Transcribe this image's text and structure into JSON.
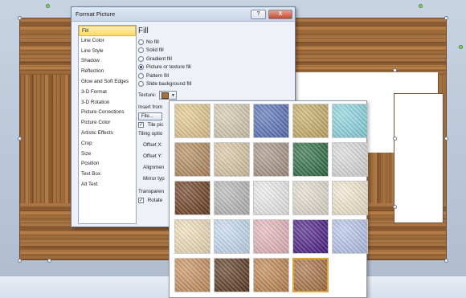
{
  "dialog": {
    "title": "Format Picture",
    "help_label": "?",
    "close_label": "X",
    "categories": [
      {
        "label": "Fill"
      },
      {
        "label": "Line Color"
      },
      {
        "label": "Line Style"
      },
      {
        "label": "Shadow"
      },
      {
        "label": "Reflection"
      },
      {
        "label": "Glow and Soft Edges"
      },
      {
        "label": "3-D Format"
      },
      {
        "label": "3-D Rotation"
      },
      {
        "label": "Picture Corrections"
      },
      {
        "label": "Picture Color"
      },
      {
        "label": "Artistic Effects"
      },
      {
        "label": "Crop"
      },
      {
        "label": "Size"
      },
      {
        "label": "Position"
      },
      {
        "label": "Text Box"
      },
      {
        "label": "Alt Text"
      }
    ],
    "fill": {
      "heading": "Fill",
      "options": [
        {
          "label": "No fill",
          "selected": false
        },
        {
          "label": "Solid fill",
          "selected": false
        },
        {
          "label": "Gradient fill",
          "selected": false
        },
        {
          "label": "Picture or texture fill",
          "selected": true
        },
        {
          "label": "Pattern fill",
          "selected": false
        },
        {
          "label": "Slide background fill",
          "selected": false
        }
      ],
      "texture_label": "Texture:",
      "insert_from_label": "Insert from",
      "file_button_label": "File...",
      "tile_label": "Tile pic",
      "tiling_options_label": "Tiling optio",
      "offset_x_label": "Offset X:",
      "offset_y_label": "Offset Y:",
      "alignment_label": "Alignmen",
      "mirror_label": "Mirror typ",
      "transparency_label": "Transparen",
      "rotate_label": "Rotate"
    }
  },
  "gallery": {
    "textures": [
      {
        "name": "Papyrus",
        "color": "#e6c98c"
      },
      {
        "name": "Canvas",
        "color": "#d8cbb0"
      },
      {
        "name": "Denim",
        "color": "#5670b8"
      },
      {
        "name": "Woven mat",
        "color": "#c8ad64"
      },
      {
        "name": "Water droplets",
        "color": "#8ad6e0"
      },
      {
        "name": "Paper bag",
        "color": "#b48a5c"
      },
      {
        "name": "Fish fossil",
        "color": "#dcc7a4"
      },
      {
        "name": "Sand",
        "color": "#a89484"
      },
      {
        "name": "Green marble",
        "color": "#2a6a40"
      },
      {
        "name": "White marble",
        "color": "#dcdcdc"
      },
      {
        "name": "Brown marble",
        "color": "#6a3a1c"
      },
      {
        "name": "Granite",
        "color": "#b8b8b8"
      },
      {
        "name": "Newsprint",
        "color": "#eeeeee"
      },
      {
        "name": "Recycled paper",
        "color": "#e6ded0"
      },
      {
        "name": "Parchment",
        "color": "#f6ead0"
      },
      {
        "name": "Stationery",
        "color": "#f2dfb8"
      },
      {
        "name": "Blue tissue paper",
        "color": "#c6dcf4"
      },
      {
        "name": "Pink tissue paper",
        "color": "#e8b6bc"
      },
      {
        "name": "Purple mesh",
        "color": "#4a1a86"
      },
      {
        "name": "Bouquet",
        "color": "#b8c6ee"
      },
      {
        "name": "Cork",
        "color": "#c8905c"
      },
      {
        "name": "Walnut",
        "color": "#5a361c"
      },
      {
        "name": "Oak",
        "color": "#c0844c"
      },
      {
        "name": "Medium wood",
        "color": "#a87040"
      }
    ],
    "selected_index": 23
  }
}
